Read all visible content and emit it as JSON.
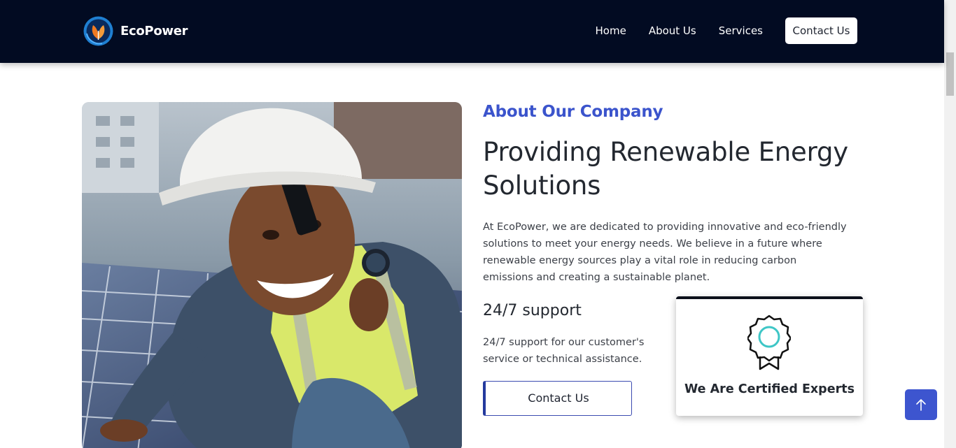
{
  "navbar": {
    "brand_name": "EcoPower",
    "logo_icon": "leaf-globe-logo",
    "links": [
      "Home",
      "About Us",
      "Services"
    ],
    "contact_label": "Contact Us"
  },
  "hero": {
    "image_alt": "Smiling worker in hard hat and safety vest talking on phone beside solar panels",
    "eyebrow": "About Our Company",
    "headline": "Providing Renewable Energy Solutions",
    "intro": "At EcoPower, we are dedicated to providing innovative and eco-friendly solutions to meet your energy needs. We believe in a future where renewable energy sources play a vital role in reducing carbon emissions and creating a sustainable planet.",
    "support_title": "24/7 support",
    "support_text": "24/7 support for our customer's service or technical assistance.",
    "contact_button": "Contact Us"
  },
  "cert_card": {
    "icon": "award-badge-icon",
    "title": "We Are Certified Experts"
  },
  "back_to_top": {
    "icon": "arrow-up-icon"
  },
  "colors": {
    "navbar_bg": "#020b22",
    "accent_blue": "#3b54cc",
    "heading_text": "#232830",
    "badge_teal": "#3ec6c6"
  }
}
